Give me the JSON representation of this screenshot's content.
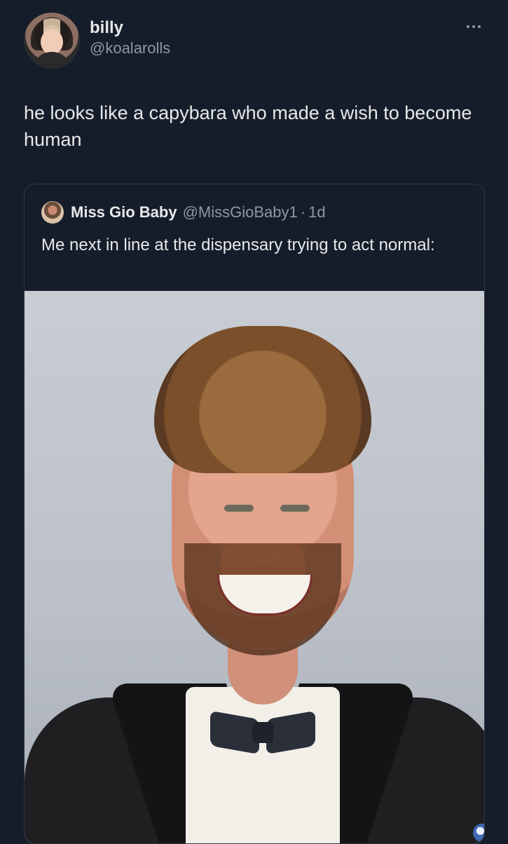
{
  "tweet": {
    "author": {
      "display_name": "billy",
      "handle": "@koalarolls"
    },
    "text": "he looks like a capybara who made a wish to become human",
    "menu_icon": "more-horizontal-icon"
  },
  "quoted_tweet": {
    "author": {
      "display_name": "Miss Gio Baby",
      "handle": "@MissGioBaby1"
    },
    "separator": "·",
    "timestamp": "1d",
    "text": "Me next in line at the dispensary trying to act normal:"
  },
  "colors": {
    "background": "#161d2a",
    "primary_text": "#e7e9ea",
    "secondary_text": "#8b98a5",
    "border": "#2f3743"
  }
}
